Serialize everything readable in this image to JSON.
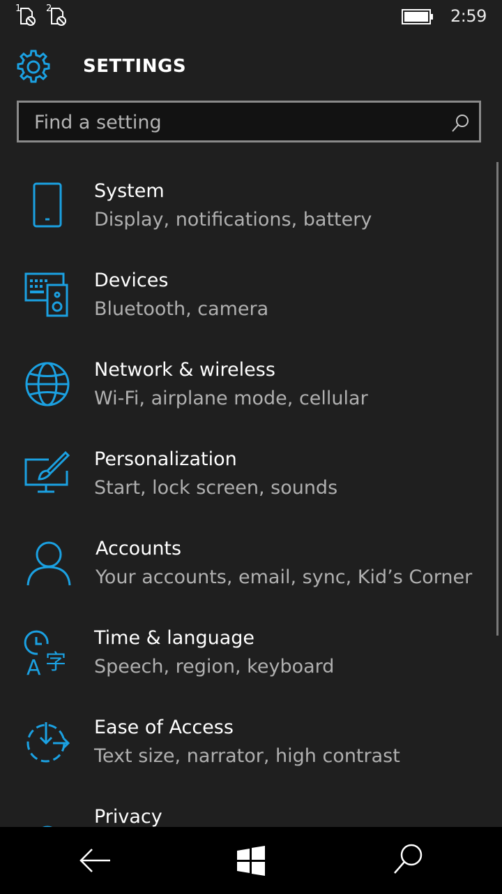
{
  "status_bar": {
    "sim1_label": "1",
    "sim2_label": "2",
    "time": "2:59",
    "battery_level": 1.0
  },
  "header": {
    "title": "SETTINGS",
    "icon": "gear-icon"
  },
  "search": {
    "placeholder": "Find a setting",
    "value": ""
  },
  "categories": [
    {
      "label": "System",
      "description": "Display, notifications, battery",
      "icon": "phone-icon"
    },
    {
      "label": "Devices",
      "description": "Bluetooth, camera",
      "icon": "devices-icon"
    },
    {
      "label": "Network & wireless",
      "description": "Wi-Fi, airplane mode, cellular",
      "icon": "globe-icon"
    },
    {
      "label": "Personalization",
      "description": "Start, lock screen, sounds",
      "icon": "personalization-icon"
    },
    {
      "label": "Accounts",
      "description": "Your accounts, email, sync, Kid’s Corner",
      "icon": "person-icon"
    },
    {
      "label": "Time & language",
      "description": "Speech, region, keyboard",
      "icon": "time-language-icon"
    },
    {
      "label": "Ease of Access",
      "description": "Text size, narrator, high contrast",
      "icon": "ease-of-access-icon"
    },
    {
      "label": "Privacy",
      "description": "",
      "icon": "lock-icon"
    }
  ],
  "navbar": {
    "back": "back-arrow-icon",
    "start": "windows-logo-icon",
    "search": "search-icon"
  },
  "colors": {
    "accent": "#1ba1e2",
    "background": "#1f1f1f",
    "secondary_text": "#b0b0b0"
  }
}
